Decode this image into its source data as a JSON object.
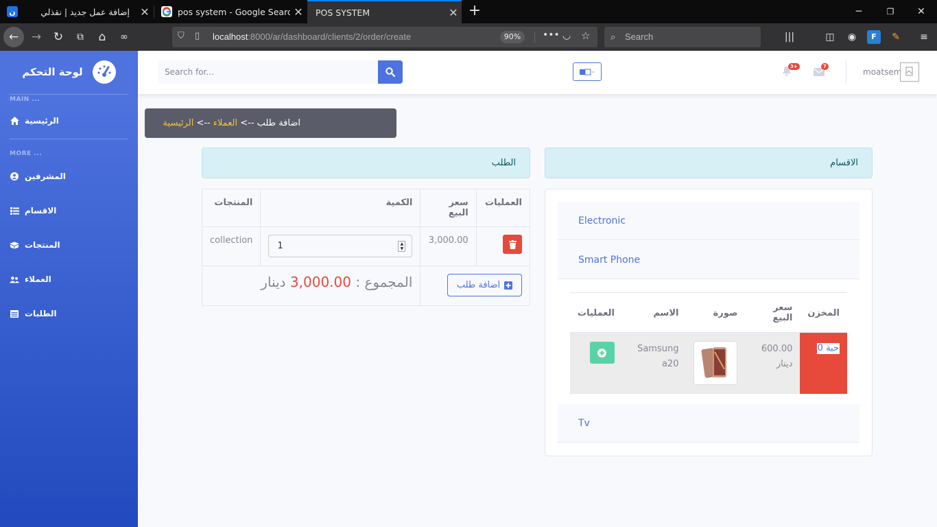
{
  "browser": {
    "tabs": [
      {
        "title": "إضافة عمل جديد | نقذلي",
        "favicon": "nafthli-logo-icon"
      },
      {
        "title": "pos system - Google Search",
        "favicon": "google-icon"
      },
      {
        "title": "POS SYSTEM",
        "favicon": ""
      }
    ],
    "url_host": "localhost",
    "url_rest": ":8000/ar/dashboard/clients/2/order/create",
    "zoom": "90%",
    "search_placeholder": "Search"
  },
  "sidebar": {
    "brand": "لوحة التحكم",
    "heading_main": "MAIN ...",
    "heading_more": "MORE ...",
    "items": [
      {
        "label": "الرئيسية",
        "icon": "home-icon"
      },
      {
        "label": "المشرفين",
        "icon": "user-circle-icon"
      },
      {
        "label": "الاقسام",
        "icon": "list-icon"
      },
      {
        "label": "المنتجات",
        "icon": "boxes-icon"
      },
      {
        "label": "العملاء",
        "icon": "users-icon"
      },
      {
        "label": "الطلبات",
        "icon": "table-icon"
      }
    ]
  },
  "topbar": {
    "search_placeholder": "Search for...",
    "alerts_badge": "3+",
    "messages_badge": "7",
    "username": "moatsem"
  },
  "breadcrumb": {
    "home": "الرئيسية",
    "sep": " --> ",
    "clients": "العملاء",
    "current": "اضافة طلب"
  },
  "order": {
    "title": "الطلب",
    "columns": [
      "المنتجات",
      "الكمية",
      "سعر البيع",
      "العمليات"
    ],
    "row": {
      "product": "collection",
      "quantity": "1",
      "price": "3,000.00"
    },
    "total_label": "المجموع :",
    "total_value": "3,000.00",
    "currency": "دينار",
    "add_order_label": "اضافة طلب"
  },
  "categories": {
    "title": "الاقسام",
    "items": [
      "Electronic",
      "Smart Phone",
      "Tv"
    ],
    "product_columns": [
      "المخزن",
      "سعر البيع",
      "صورة",
      "الاسم",
      "العمليات"
    ],
    "product": {
      "stock": "حبة 0",
      "price": "600.00",
      "currency": "دينار",
      "name": "Samsung a20"
    }
  },
  "colors": {
    "primary": "#4e73df",
    "danger": "#e74a3b",
    "success": "#1cc88a",
    "info_bg": "#d7f0f5"
  }
}
